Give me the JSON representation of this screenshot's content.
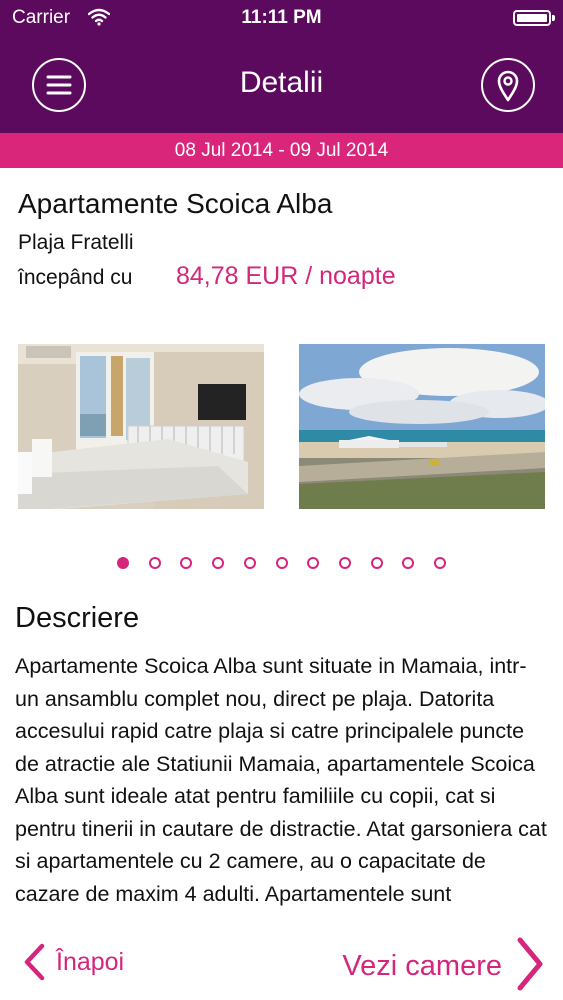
{
  "status_bar": {
    "carrier": "Carrier",
    "time": "11:11 PM",
    "wifi_icon": "wifi-icon",
    "battery_icon": "battery-icon"
  },
  "nav": {
    "title": "Detalii",
    "left_icon": "menu-icon",
    "right_icon": "map-pin-icon"
  },
  "dates": "08 Jul 2014 - 09 Jul 2014",
  "hotel": {
    "name": "Apartamente Scoica Alba",
    "location": "Plaja Fratelli",
    "price_prefix": "începând cu",
    "price": "84,78 EUR / noapte"
  },
  "gallery": {
    "photo_count": 11,
    "active_index": 0
  },
  "description": {
    "heading": "Descriere",
    "text": "Apartamente Scoica Alba sunt situate in Mamaia, intr-un ansamblu complet nou, direct pe plaja. Datorita accesului rapid catre plaja si catre principalele puncte de atractie ale Statiunii Mamaia, apartamentele Scoica Alba sunt ideale atat pentru familiile cu copii, cat si pentru tinerii in cautare de distractie. Atat garsoniera cat si apartamentele cu 2 camere, au o capacitate de cazare de maxim 4 adulti. Apartamentele sunt"
  },
  "footer": {
    "back_label": "Înapoi",
    "next_label": "Vezi camere"
  },
  "colors": {
    "header": "#5c0a5e",
    "accent": "#d4267a",
    "date_bar": "#d9267a"
  }
}
